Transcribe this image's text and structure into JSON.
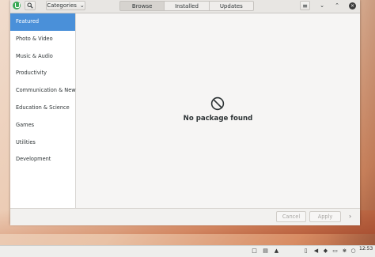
{
  "colors": {
    "accent": "#4a90d9",
    "app_icon": "#3aaa57"
  },
  "header": {
    "categories_label": "Categories",
    "tabs": [
      {
        "label": "Browse",
        "active": true
      },
      {
        "label": "Installed",
        "active": false
      },
      {
        "label": "Updates",
        "active": false
      }
    ],
    "icons": [
      "app-icon",
      "search-icon",
      "chevron-down-icon",
      "hamburger-menu-icon",
      "minimize-icon",
      "maximize-icon",
      "close-icon"
    ]
  },
  "sidebar": {
    "items": [
      {
        "label": "Featured",
        "selected": true
      },
      {
        "label": "Photo & Video",
        "selected": false
      },
      {
        "label": "Music & Audio",
        "selected": false
      },
      {
        "label": "Productivity",
        "selected": false
      },
      {
        "label": "Communication & News",
        "selected": false
      },
      {
        "label": "Education & Science",
        "selected": false
      },
      {
        "label": "Games",
        "selected": false
      },
      {
        "label": "Utilities",
        "selected": false
      },
      {
        "label": "Development",
        "selected": false
      }
    ]
  },
  "main": {
    "empty_icon": "no-entry-icon",
    "empty_text": "No package found"
  },
  "footer": {
    "cancel_label": "Cancel",
    "apply_label": "Apply",
    "next_icon": "chevron-right-icon"
  },
  "taskbar": {
    "clock_time": "12:53",
    "clock_date": "",
    "icons": [
      "window-icon",
      "clipboard-icon",
      "network-icon",
      "battery-icon",
      "volume-icon",
      "shield-icon",
      "display-icon",
      "bluetooth-icon",
      "notification-icon"
    ]
  }
}
